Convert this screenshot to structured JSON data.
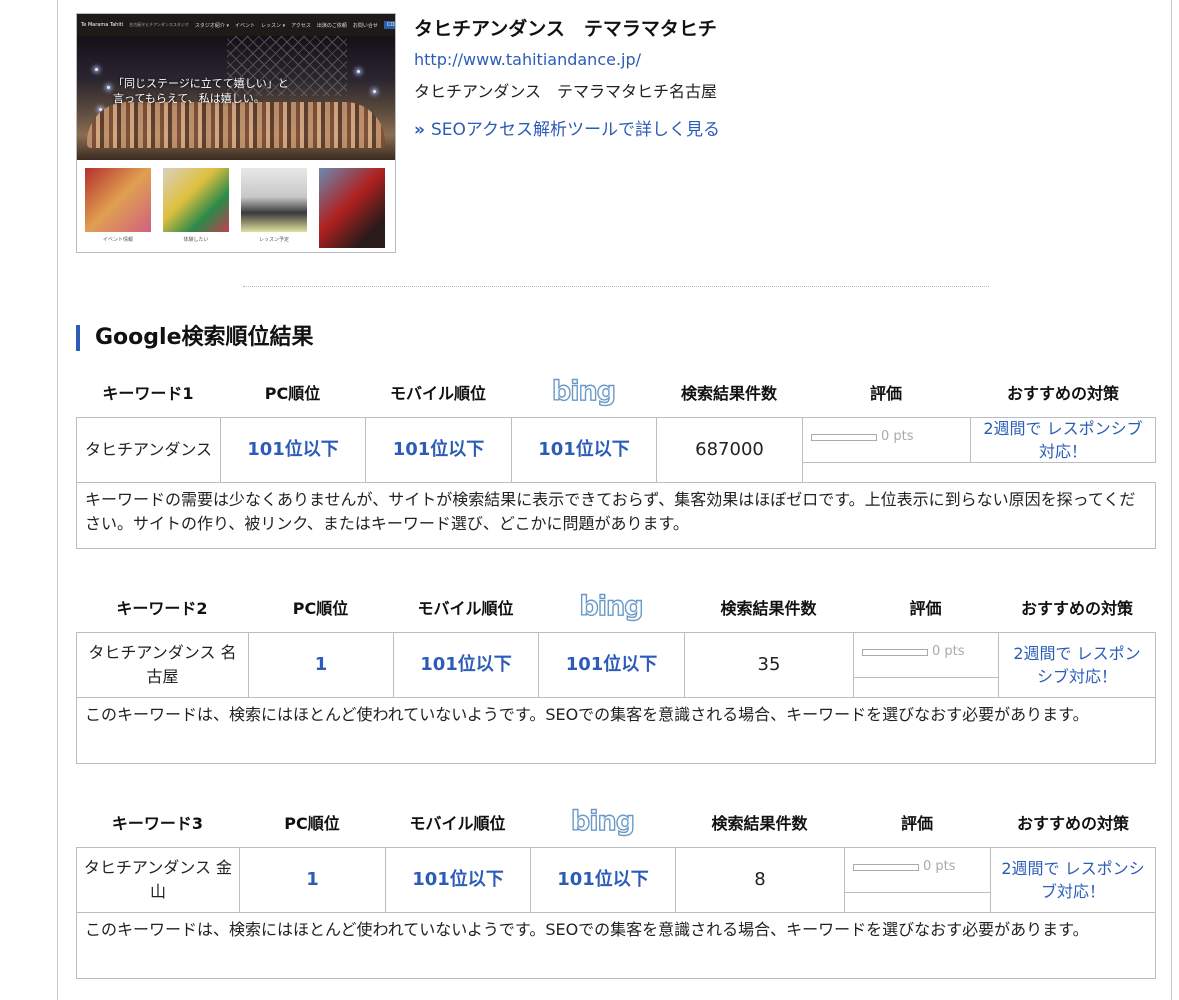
{
  "site": {
    "thumbnail": {
      "nav_brand": "Te Marama Tahiti",
      "nav_brand_sub": "名古屋タヒチアンダンススタジオ",
      "nav_items": [
        "スタジオ紹介 ▾",
        "イベント",
        "レッスン ▾",
        "アクセス",
        "出演のご依頼",
        "お問い合せ"
      ],
      "nav_contact": "CONTACT",
      "hero_caption_line1": "「同じステージに立てて嬉しい」と",
      "hero_caption_line2": "言ってもらえて、私は嬉しい。",
      "tiles": [
        {
          "label": "イベント情報"
        },
        {
          "label": "体験したい"
        },
        {
          "label": "レッスン予定"
        },
        {
          "label": ""
        }
      ]
    },
    "title": "タヒチアンダンス　テマラマタヒチ",
    "url": "http://www.tahitiandance.jp/",
    "description": "タヒチアンダンス　テマラマタヒチ名古屋",
    "seo_link_arrow": "»",
    "seo_link_label": "SEOアクセス解析ツールで詳しく見る"
  },
  "section_title": "Google検索順位結果",
  "columns": {
    "pc": "PC順位",
    "mobile": "モバイル順位",
    "bing": "bing",
    "count": "検索結果件数",
    "eval": "評価",
    "rec": "おすすめの対策"
  },
  "keywords": [
    {
      "header": "キーワード1",
      "keyword": "タヒチアンダンス",
      "pc_rank": "101位以下",
      "mobile_rank": "101位以下",
      "bing_rank": "101位以下",
      "result_count": "687000",
      "score": 0,
      "score_text": "0 pts",
      "recommendation": "2週間で レスポンシブ対応！",
      "comment": "キーワードの需要は少なくありませんが、サイトが検索結果に表示できておらず、集客効果はほぼゼロです。上位表示に到らない原因を探ってください。サイトの作り、被リンク、またはキーワード選び、どこかに問題があります。"
    },
    {
      "header": "キーワード2",
      "keyword": "タヒチアンダンス 名古屋",
      "pc_rank": "1",
      "mobile_rank": "101位以下",
      "bing_rank": "101位以下",
      "result_count": "35",
      "score": 0,
      "score_text": "0 pts",
      "recommendation": "2週間で レスポンシブ対応！",
      "comment": "このキーワードは、検索にはほとんど使われていないようです。SEOでの集客を意識される場合、キーワードを選びなおす必要があります。"
    },
    {
      "header": "キーワード3",
      "keyword": "タヒチアンダンス 金山",
      "pc_rank": "1",
      "mobile_rank": "101位以下",
      "bing_rank": "101位以下",
      "result_count": "8",
      "score": 0,
      "score_text": "0 pts",
      "recommendation": "2週間で レスポンシブ対応！",
      "comment": "このキーワードは、検索にはほとんど使われていないようです。SEOでの集客を意識される場合、キーワードを選びなおす必要があります。"
    }
  ]
}
